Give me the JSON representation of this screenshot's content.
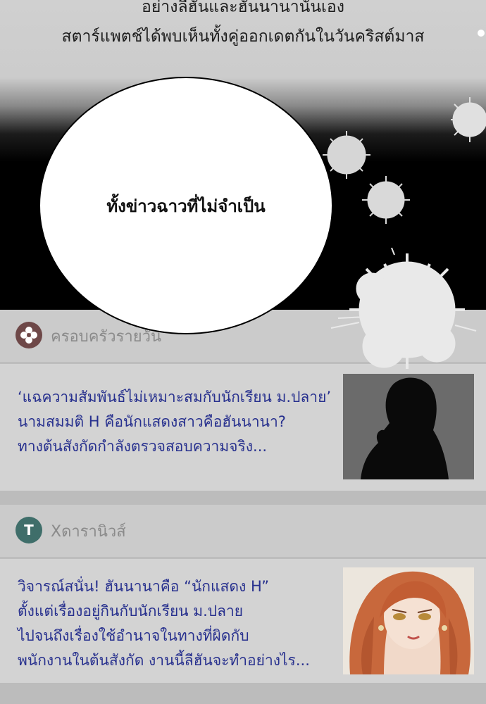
{
  "caption": {
    "line1": "อย่างลีฮันและฮันนานานั่นเอง",
    "line2": "สตาร์แพตช์ได้พบเห็นทั้งคู่ออกเดตกันในวันคริสต์มาส"
  },
  "bubble": {
    "text": "ทั้งข่าวฉาวที่ไม่จำเป็น"
  },
  "news": [
    {
      "source": "ครอบครัวรายวัน",
      "source_color": "#6e4848",
      "headline": [
        "‘แฉความสัมพันธ์ไม่เหมาะสมกับนักเรียน ม.ปลาย’",
        "นามสมมติ H คือนักแสดงสาวคือฮันนานา?",
        "ทางต้นสังกัดกำลังตรวจสอบความจริง..."
      ]
    },
    {
      "source": "Xดารานิวส์",
      "source_icon_letter": "T",
      "source_color": "#3f6e6a",
      "headline": [
        "วิจารณ์สนั่น! ฮันนานาคือ “นักแสดง H”",
        "ตั้งแต่เรื่องอยู่กินกับนักเรียน ม.ปลาย",
        "ไปจนถึงเรื่องใช้อำนาจในทางที่ผิดกับ",
        "พนักงานในต้นสังกัด งานนี้ลีฮันจะทำอย่างไร..."
      ]
    }
  ],
  "colors": {
    "headline": "#27308e",
    "source_text": "#8a8a8a"
  }
}
